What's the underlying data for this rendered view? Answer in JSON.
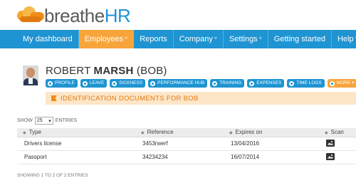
{
  "logo": {
    "part1": "breathe",
    "part2": "HR",
    "icon": "cloud-logo"
  },
  "nav": {
    "items": [
      {
        "label": "My dashboard",
        "active": false,
        "dropdown": false
      },
      {
        "label": "Employees",
        "active": true,
        "dropdown": true
      },
      {
        "label": "Reports",
        "active": false,
        "dropdown": false
      },
      {
        "label": "Company",
        "active": false,
        "dropdown": true
      },
      {
        "label": "Settings",
        "active": false,
        "dropdown": true
      },
      {
        "label": "Getting started",
        "active": false,
        "dropdown": false
      },
      {
        "label": "Help",
        "active": false,
        "dropdown": true
      }
    ],
    "caret": "˅"
  },
  "profile": {
    "first": "ROBERT",
    "last": "MARSH",
    "nick": "(BOB)"
  },
  "actions": [
    "PROFILE",
    "LEAVE",
    "SICKNESS",
    "PERFORMANCE HUB",
    "TRAINING",
    "EXPENSES",
    "TIME LOGS",
    "MORE ▾"
  ],
  "section_title": "IDENTIFICATION DOCUMENTS FOR BOB",
  "table_controls": {
    "show": "SHOW",
    "entries_value": "25",
    "entries": "ENTRIES"
  },
  "table": {
    "headers": [
      "Type",
      "Reference",
      "Expires on",
      "Scan"
    ],
    "rows": [
      {
        "type": "Drivers license",
        "reference": "3453rwerf",
        "expires": "13/04/2016"
      },
      {
        "type": "Passport",
        "reference": "34234234",
        "expires": "16/07/2014"
      }
    ]
  },
  "footer": "SHOWING 1 TO 2 OF 2 ENTRIES",
  "colors": {
    "primary": "#1e94d2",
    "accent": "#f7a53b",
    "banner_bg": "#fde6c8"
  }
}
